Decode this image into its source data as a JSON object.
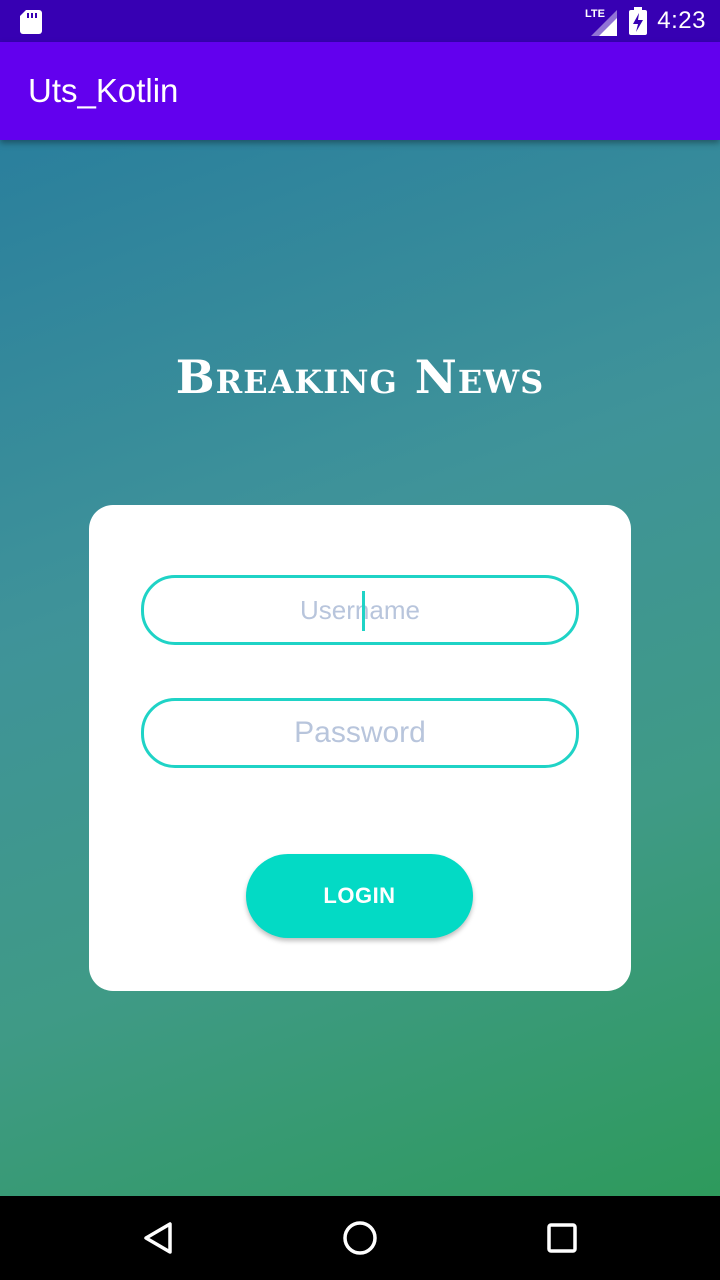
{
  "status_bar": {
    "time": "4:23",
    "network_label": "LTE",
    "icons": [
      "sd-card-icon",
      "signal-icon",
      "battery-charging-icon"
    ],
    "background": "#3700b3"
  },
  "app_bar": {
    "title": "Uts_Kotlin",
    "background": "#6200ee"
  },
  "main": {
    "brand_title": "Breaking News",
    "background_gradient": [
      "#2a7f9d",
      "#3f9399",
      "#3f9a86",
      "#2e9a5c"
    ]
  },
  "login_form": {
    "username": {
      "value": "",
      "placeholder": "Username"
    },
    "password": {
      "value": "",
      "placeholder": "Password"
    },
    "login_label": "LOGIN",
    "accent": "#03dac5",
    "border_color": "#1fd3c6"
  },
  "nav_bar": {
    "icons": [
      "back-icon",
      "home-icon",
      "recents-icon"
    ]
  }
}
